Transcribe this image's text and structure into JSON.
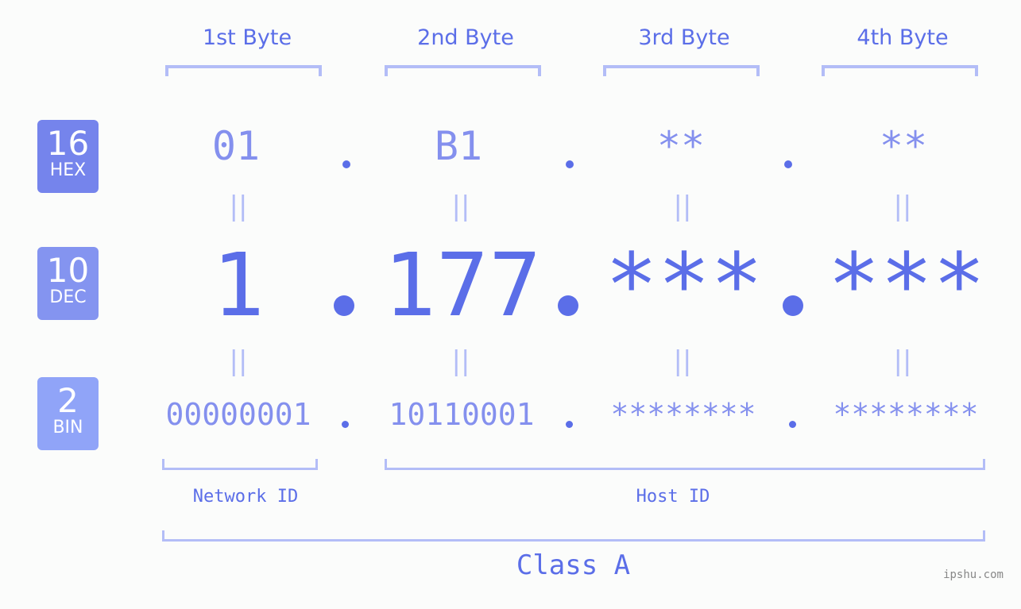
{
  "bytes": [
    {
      "label": "1st Byte",
      "hex": "01",
      "dec": "1",
      "bin": "00000001"
    },
    {
      "label": "2nd Byte",
      "hex": "B1",
      "dec": "177",
      "bin": "10110001"
    },
    {
      "label": "3rd Byte",
      "hex": "**",
      "dec": "***",
      "bin": "********"
    },
    {
      "label": "4th Byte",
      "hex": "**",
      "dec": "***",
      "bin": "********"
    }
  ],
  "badges": {
    "hex": {
      "number": "16",
      "tag": "HEX",
      "color": "#7584ec"
    },
    "dec": {
      "number": "10",
      "tag": "DEC",
      "color": "#8494f0"
    },
    "bin": {
      "number": "2",
      "tag": "BIN",
      "color": "#90a4f8"
    }
  },
  "equals_symbol": "||",
  "network_id_label": "Network ID",
  "host_id_label": "Host ID",
  "class_label": "Class A",
  "watermark": "ipshu.com",
  "colors": {
    "primary": "#5b6ee8",
    "secondary": "#8490ee",
    "bracket": "#b3bdf7",
    "background": "#fbfcfb"
  }
}
